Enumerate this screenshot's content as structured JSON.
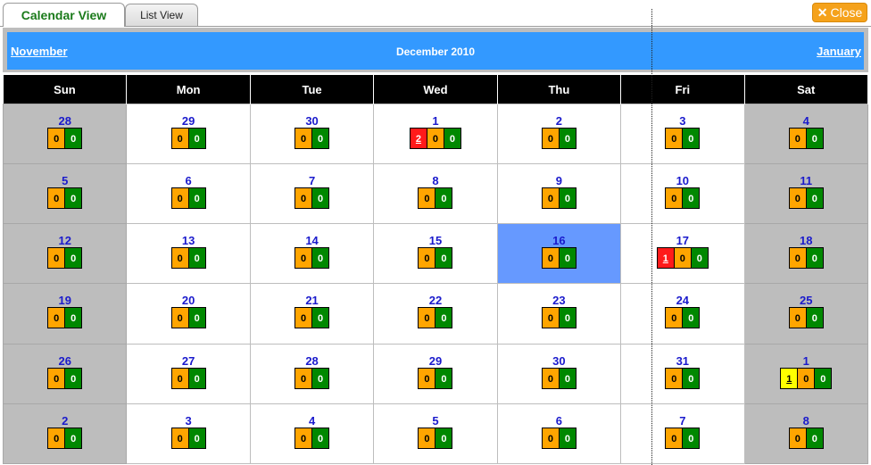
{
  "tabs": {
    "calendar": "Calendar View",
    "list": "List View"
  },
  "close": {
    "label": "Close",
    "icon": "close-icon"
  },
  "nav": {
    "prev": "November",
    "current": "December 2010",
    "next": "January"
  },
  "weekdays": [
    "Sun",
    "Mon",
    "Tue",
    "Wed",
    "Thu",
    "Fri",
    "Sat"
  ],
  "colors": {
    "red": "#ff1a1a",
    "yellow": "#ffff00",
    "orange": "#ffa500",
    "green": "#008800",
    "today": "#6699ff",
    "header": "#3399ff"
  },
  "weeks": [
    [
      {
        "day": "28",
        "weekend": true,
        "badges": [
          {
            "c": "orange",
            "v": "0"
          },
          {
            "c": "green",
            "v": "0"
          }
        ]
      },
      {
        "day": "29",
        "badges": [
          {
            "c": "orange",
            "v": "0"
          },
          {
            "c": "green",
            "v": "0"
          }
        ]
      },
      {
        "day": "30",
        "badges": [
          {
            "c": "orange",
            "v": "0"
          },
          {
            "c": "green",
            "v": "0"
          }
        ]
      },
      {
        "day": "1",
        "badges": [
          {
            "c": "red",
            "v": "2"
          },
          {
            "c": "orange",
            "v": "0"
          },
          {
            "c": "green",
            "v": "0"
          }
        ]
      },
      {
        "day": "2",
        "badges": [
          {
            "c": "orange",
            "v": "0"
          },
          {
            "c": "green",
            "v": "0"
          }
        ]
      },
      {
        "day": "3",
        "badges": [
          {
            "c": "orange",
            "v": "0"
          },
          {
            "c": "green",
            "v": "0"
          }
        ]
      },
      {
        "day": "4",
        "weekend": true,
        "badges": [
          {
            "c": "orange",
            "v": "0"
          },
          {
            "c": "green",
            "v": "0"
          }
        ]
      }
    ],
    [
      {
        "day": "5",
        "weekend": true,
        "badges": [
          {
            "c": "orange",
            "v": "0"
          },
          {
            "c": "green",
            "v": "0"
          }
        ]
      },
      {
        "day": "6",
        "badges": [
          {
            "c": "orange",
            "v": "0"
          },
          {
            "c": "green",
            "v": "0"
          }
        ]
      },
      {
        "day": "7",
        "badges": [
          {
            "c": "orange",
            "v": "0"
          },
          {
            "c": "green",
            "v": "0"
          }
        ]
      },
      {
        "day": "8",
        "badges": [
          {
            "c": "orange",
            "v": "0"
          },
          {
            "c": "green",
            "v": "0"
          }
        ]
      },
      {
        "day": "9",
        "badges": [
          {
            "c": "orange",
            "v": "0"
          },
          {
            "c": "green",
            "v": "0"
          }
        ]
      },
      {
        "day": "10",
        "badges": [
          {
            "c": "orange",
            "v": "0"
          },
          {
            "c": "green",
            "v": "0"
          }
        ]
      },
      {
        "day": "11",
        "weekend": true,
        "badges": [
          {
            "c": "orange",
            "v": "0"
          },
          {
            "c": "green",
            "v": "0"
          }
        ]
      }
    ],
    [
      {
        "day": "12",
        "weekend": true,
        "badges": [
          {
            "c": "orange",
            "v": "0"
          },
          {
            "c": "green",
            "v": "0"
          }
        ]
      },
      {
        "day": "13",
        "badges": [
          {
            "c": "orange",
            "v": "0"
          },
          {
            "c": "green",
            "v": "0"
          }
        ]
      },
      {
        "day": "14",
        "badges": [
          {
            "c": "orange",
            "v": "0"
          },
          {
            "c": "green",
            "v": "0"
          }
        ]
      },
      {
        "day": "15",
        "badges": [
          {
            "c": "orange",
            "v": "0"
          },
          {
            "c": "green",
            "v": "0"
          }
        ]
      },
      {
        "day": "16",
        "today": true,
        "badges": [
          {
            "c": "orange",
            "v": "0"
          },
          {
            "c": "green",
            "v": "0"
          }
        ]
      },
      {
        "day": "17",
        "badges": [
          {
            "c": "red",
            "v": "1"
          },
          {
            "c": "orange",
            "v": "0"
          },
          {
            "c": "green",
            "v": "0"
          }
        ]
      },
      {
        "day": "18",
        "weekend": true,
        "badges": [
          {
            "c": "orange",
            "v": "0"
          },
          {
            "c": "green",
            "v": "0"
          }
        ]
      }
    ],
    [
      {
        "day": "19",
        "weekend": true,
        "badges": [
          {
            "c": "orange",
            "v": "0"
          },
          {
            "c": "green",
            "v": "0"
          }
        ]
      },
      {
        "day": "20",
        "badges": [
          {
            "c": "orange",
            "v": "0"
          },
          {
            "c": "green",
            "v": "0"
          }
        ]
      },
      {
        "day": "21",
        "badges": [
          {
            "c": "orange",
            "v": "0"
          },
          {
            "c": "green",
            "v": "0"
          }
        ]
      },
      {
        "day": "22",
        "badges": [
          {
            "c": "orange",
            "v": "0"
          },
          {
            "c": "green",
            "v": "0"
          }
        ]
      },
      {
        "day": "23",
        "badges": [
          {
            "c": "orange",
            "v": "0"
          },
          {
            "c": "green",
            "v": "0"
          }
        ]
      },
      {
        "day": "24",
        "badges": [
          {
            "c": "orange",
            "v": "0"
          },
          {
            "c": "green",
            "v": "0"
          }
        ]
      },
      {
        "day": "25",
        "weekend": true,
        "badges": [
          {
            "c": "orange",
            "v": "0"
          },
          {
            "c": "green",
            "v": "0"
          }
        ]
      }
    ],
    [
      {
        "day": "26",
        "weekend": true,
        "badges": [
          {
            "c": "orange",
            "v": "0"
          },
          {
            "c": "green",
            "v": "0"
          }
        ]
      },
      {
        "day": "27",
        "badges": [
          {
            "c": "orange",
            "v": "0"
          },
          {
            "c": "green",
            "v": "0"
          }
        ]
      },
      {
        "day": "28",
        "badges": [
          {
            "c": "orange",
            "v": "0"
          },
          {
            "c": "green",
            "v": "0"
          }
        ]
      },
      {
        "day": "29",
        "badges": [
          {
            "c": "orange",
            "v": "0"
          },
          {
            "c": "green",
            "v": "0"
          }
        ]
      },
      {
        "day": "30",
        "badges": [
          {
            "c": "orange",
            "v": "0"
          },
          {
            "c": "green",
            "v": "0"
          }
        ]
      },
      {
        "day": "31",
        "badges": [
          {
            "c": "orange",
            "v": "0"
          },
          {
            "c": "green",
            "v": "0"
          }
        ]
      },
      {
        "day": "1",
        "weekend": true,
        "badges": [
          {
            "c": "yellow",
            "v": "1"
          },
          {
            "c": "orange",
            "v": "0"
          },
          {
            "c": "green",
            "v": "0"
          }
        ]
      }
    ],
    [
      {
        "day": "2",
        "weekend": true,
        "badges": [
          {
            "c": "orange",
            "v": "0"
          },
          {
            "c": "green",
            "v": "0"
          }
        ]
      },
      {
        "day": "3",
        "badges": [
          {
            "c": "orange",
            "v": "0"
          },
          {
            "c": "green",
            "v": "0"
          }
        ]
      },
      {
        "day": "4",
        "badges": [
          {
            "c": "orange",
            "v": "0"
          },
          {
            "c": "green",
            "v": "0"
          }
        ]
      },
      {
        "day": "5",
        "badges": [
          {
            "c": "orange",
            "v": "0"
          },
          {
            "c": "green",
            "v": "0"
          }
        ]
      },
      {
        "day": "6",
        "badges": [
          {
            "c": "orange",
            "v": "0"
          },
          {
            "c": "green",
            "v": "0"
          }
        ]
      },
      {
        "day": "7",
        "badges": [
          {
            "c": "orange",
            "v": "0"
          },
          {
            "c": "green",
            "v": "0"
          }
        ]
      },
      {
        "day": "8",
        "weekend": true,
        "badges": [
          {
            "c": "orange",
            "v": "0"
          },
          {
            "c": "green",
            "v": "0"
          }
        ]
      }
    ]
  ]
}
